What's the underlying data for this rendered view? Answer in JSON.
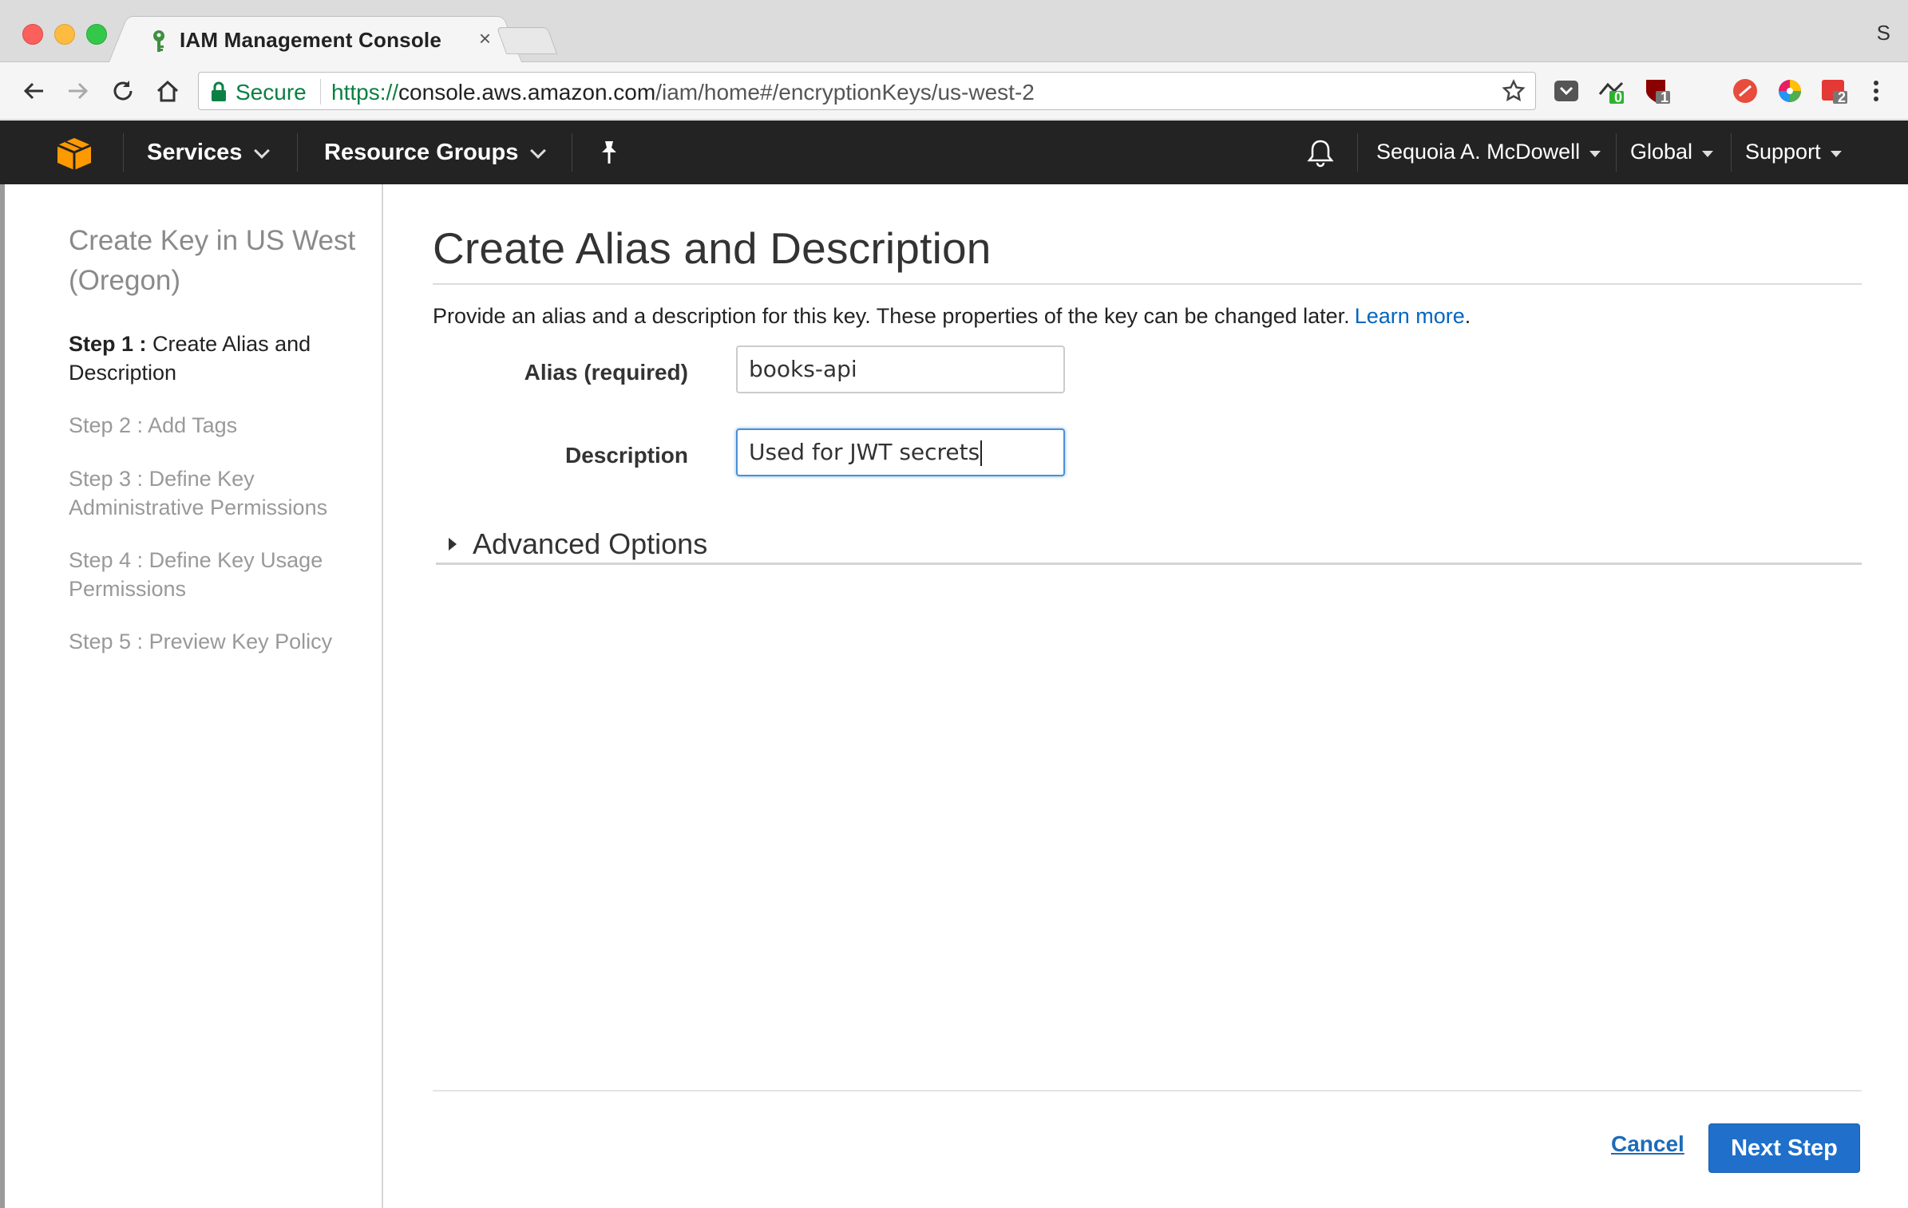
{
  "browser": {
    "tab_title": "IAM Management Console",
    "profile_initial": "S",
    "secure_label": "Secure",
    "url_scheme": "https://",
    "url_host": "console.aws.amazon.com",
    "url_path": "/iam/home#/encryptionKeys/us-west-2",
    "extension_badges": [
      "0",
      "1",
      "2"
    ]
  },
  "aws_nav": {
    "services": "Services",
    "resource_groups": "Resource Groups",
    "user": "Sequoia A. McDowell",
    "region": "Global",
    "support": "Support"
  },
  "sidebar": {
    "title": "Create Key in US West (Oregon)",
    "steps": [
      {
        "prefix": "Step 1 :",
        "label": "Create Alias and Description"
      },
      {
        "prefix": "Step 2 :",
        "label": "Add Tags"
      },
      {
        "prefix": "Step 3 :",
        "label": "Define Key Administrative Permissions"
      },
      {
        "prefix": "Step 4 :",
        "label": "Define Key Usage Permissions"
      },
      {
        "prefix": "Step 5 :",
        "label": "Preview Key Policy"
      }
    ]
  },
  "main": {
    "heading": "Create Alias and Description",
    "intro": "Provide an alias and a description for this key. These properties of the key can be changed later.",
    "learn_more": "Learn more",
    "period": ".",
    "alias_label": "Alias (required)",
    "alias_value": "books-api",
    "description_label": "Description",
    "description_value": "Used for JWT secrets",
    "advanced_options": "Advanced Options"
  },
  "footer": {
    "cancel": "Cancel",
    "next": "Next Step"
  },
  "colors": {
    "aws_nav_bg": "#232323",
    "aws_orange": "#f90",
    "link_blue": "#0066c0",
    "primary_button": "#1f6fcb",
    "secure_green": "#0b8043"
  }
}
